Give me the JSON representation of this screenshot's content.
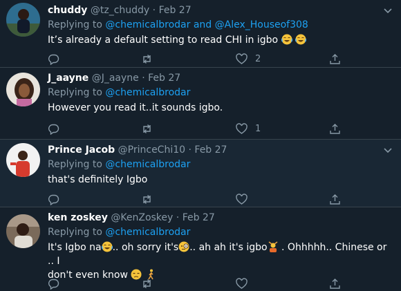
{
  "tweets": [
    {
      "name": "chuddy",
      "handle": "@tz_chuddy",
      "sep": "·",
      "date": "Feb 27",
      "reply_prefix": "Replying to ",
      "reply_mentions": "@chemicalbrodar and @Alex_Houseof308",
      "text_1": "It’s already a default setting to read CHI in igbo ",
      "text_2": "",
      "likes": "2",
      "emoji": [
        "face-with-tears-of-joy",
        "face-with-tears-of-joy"
      ]
    },
    {
      "name": "J_aayne",
      "handle": "@J_aayne",
      "sep": "·",
      "date": "Feb 27",
      "reply_prefix": "Replying to ",
      "reply_mentions": "@chemicalbrodar",
      "text_1": "However you read it..it sounds igbo.",
      "likes": "1"
    },
    {
      "name": "Prince Jacob",
      "handle": "@PrinceChi10",
      "sep": "·",
      "date": "Feb 27",
      "reply_prefix": "Replying to ",
      "reply_mentions": "@chemicalbrodar",
      "text_1": "that's definitely Igbo",
      "likes": ""
    },
    {
      "name": "ken zoskey",
      "handle": "@KenZoskey",
      "sep": "·",
      "date": "Feb 27",
      "reply_prefix": "Replying to ",
      "reply_mentions": "@chemicalbrodar",
      "seg_1": "It's Igbo na",
      "seg_2": ".. oh sorry it's",
      "seg_3": ".. ah ah it's igbo",
      "seg_4": " . Ohhhhh.. Chinese or .. I",
      "seg_5": "don't even know ",
      "likes": "",
      "emoji": [
        "face-with-tears-of-joy",
        "face-with-monocle",
        "person-gesturing-ok",
        "unamused-face",
        "person-walking"
      ]
    }
  ],
  "colors": {
    "background": "#15202b",
    "background_alt": "#192734",
    "divider": "#38444d",
    "muted": "#8899a6",
    "link": "#1da1f2"
  },
  "icons": [
    "reply-icon",
    "retweet-icon",
    "like-icon",
    "share-icon",
    "caret-down-icon"
  ]
}
